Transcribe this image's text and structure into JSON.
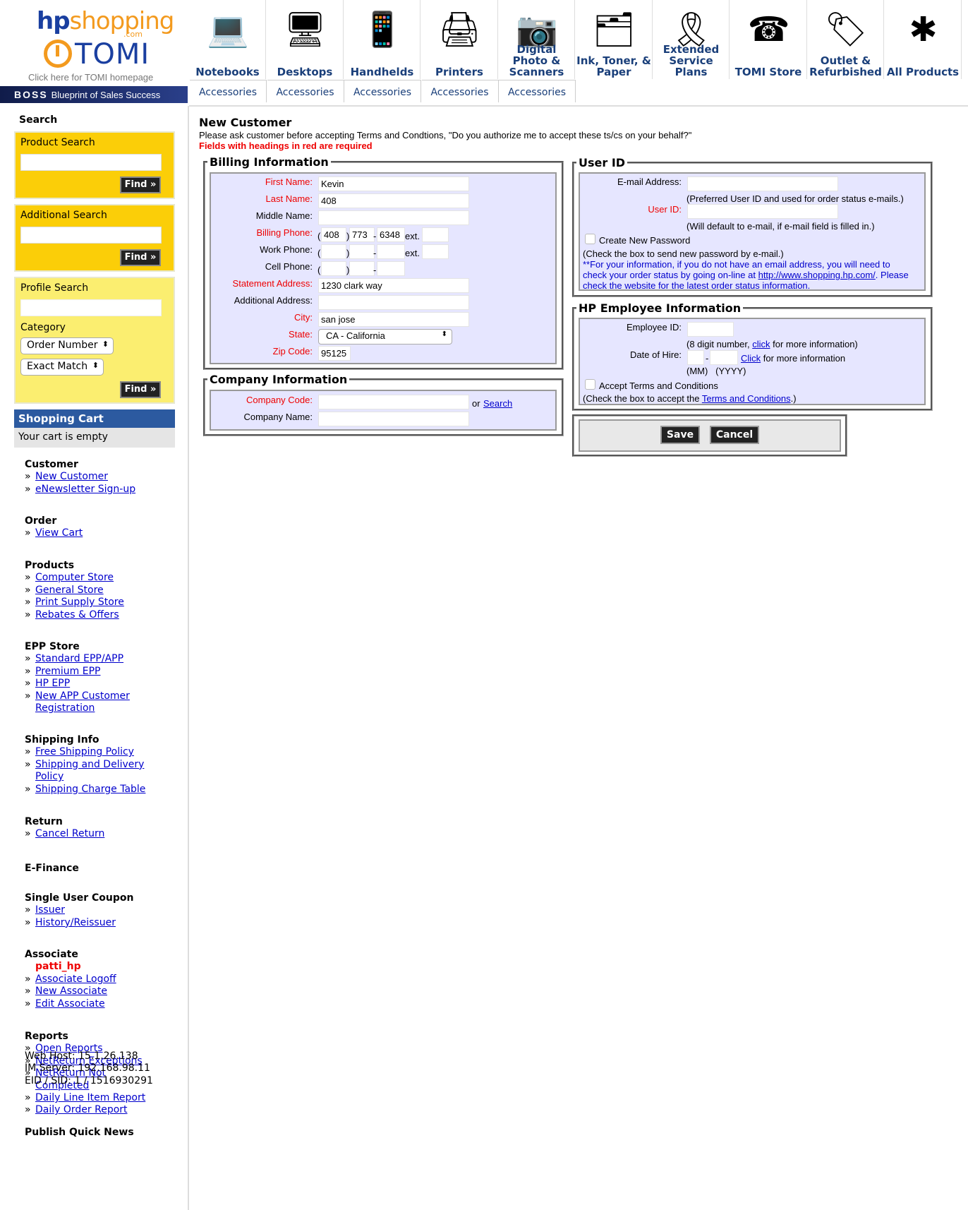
{
  "logo": {
    "hp": "hp",
    "shopping": "shopping",
    "com": ".com",
    "tomi": "TOMI",
    "caption": "Click here for TOMI homepage",
    "boss": "BOSS",
    "boss_tagline": "Blueprint of Sales Success"
  },
  "nav": {
    "categories": [
      {
        "label": "Notebooks",
        "icon": "laptop-icon",
        "glyph": "💻"
      },
      {
        "label": "Desktops",
        "icon": "desktop-icon",
        "glyph": "🖥"
      },
      {
        "label": "Handhelds",
        "icon": "handheld-icon",
        "glyph": "📱"
      },
      {
        "label": "Printers",
        "icon": "printer-icon",
        "glyph": "🖨"
      },
      {
        "label": "Digital Photo & Scanners",
        "icon": "camera-icon",
        "glyph": "📷"
      },
      {
        "label": "Ink, Toner, & Paper",
        "icon": "ink-icon",
        "glyph": "🗂"
      },
      {
        "label": "Extended Service Plans",
        "icon": "ribbon-icon",
        "glyph": "🎗"
      },
      {
        "label": "TOMI Store",
        "icon": "phone-icon",
        "glyph": "☎"
      },
      {
        "label": "Outlet & Refurbished",
        "icon": "tag-icon",
        "glyph": "🏷"
      },
      {
        "label": "All Products",
        "icon": "asterisk-icon",
        "glyph": "✱"
      }
    ],
    "accessories": [
      "Accessories",
      "Accessories",
      "Accessories",
      "Accessories",
      "Accessories"
    ]
  },
  "sidebar": {
    "search_title": "Search",
    "product_search": {
      "title": "Product Search",
      "find": "Find »"
    },
    "additional_search": {
      "title": "Additional Search",
      "find": "Find »"
    },
    "profile_search": {
      "title": "Profile Search",
      "category_label": "Category",
      "category_value": "Order Number",
      "match_value": "Exact Match",
      "find": "Find »"
    },
    "cart": {
      "title": "Shopping Cart",
      "status": "Your cart is empty"
    },
    "sections": {
      "customer": {
        "title": "Customer",
        "links": [
          "New Customer",
          "eNewsletter Sign-up"
        ]
      },
      "order": {
        "title": "Order",
        "links": [
          "View Cart"
        ]
      },
      "products": {
        "title": "Products",
        "links": [
          "Computer Store",
          "General Store",
          "Print Supply Store",
          "Rebates & Offers"
        ]
      },
      "epp": {
        "title": "EPP Store",
        "links": [
          "Standard EPP/APP",
          "Premium EPP",
          "HP EPP",
          "New APP Customer Registration"
        ]
      },
      "shipping": {
        "title": "Shipping Info",
        "links": [
          "Free Shipping Policy",
          "Shipping and Delivery Policy",
          "Shipping Charge Table"
        ]
      },
      "return": {
        "title": "Return",
        "links": [
          "Cancel Return"
        ]
      },
      "efinance": {
        "title": "E-Finance"
      },
      "coupon": {
        "title": "Single User Coupon",
        "links": [
          "Issuer",
          "History/Reissuer"
        ]
      },
      "associate": {
        "title": "Associate",
        "user": "patti_hp",
        "links": [
          "Associate Logoff",
          "New Associate",
          "Edit Associate"
        ]
      },
      "reports": {
        "title": "Reports",
        "links": [
          "Open Reports",
          "NetReturn Exceptions",
          "NetReturn Not Completed",
          "Daily Line Item Report",
          "Daily Order Report"
        ]
      },
      "news": {
        "title": "Publish Quick News"
      }
    },
    "server": {
      "web_host": "Web Host: 15.1.26.138",
      "im_server": "IM Server: 192.168.98.11",
      "eid_sid": "EID / SID: 1 / 1516930291"
    }
  },
  "form": {
    "title": "New Customer",
    "instruction": "Please ask customer before accepting Terms and Condtions, \"Do you authorize me to accept these ts/cs on your behalf?\"",
    "required_note": "Fields with headings in red are required",
    "billing": {
      "legend": "Billing Information",
      "first_name_label": "First Name:",
      "first_name": "Kevin",
      "last_name_label": "Last Name:",
      "last_name": "408",
      "middle_name_label": "Middle Name:",
      "middle_name": "",
      "billing_phone_label": "Billing Phone:",
      "billing_phone_area": "408",
      "billing_phone_prefix": "773",
      "billing_phone_line": "6348",
      "work_phone_label": "Work Phone:",
      "cell_phone_label": "Cell Phone:",
      "ext_label": "ext.",
      "paren_open": "(",
      "paren_close": ")",
      "dash": "-",
      "statement_address_label": "Statement Address:",
      "statement_address": "1230 clark way",
      "additional_address_label": "Additional Address:",
      "additional_address": "",
      "city_label": "City:",
      "city": "san jose",
      "state_label": "State:",
      "state": "CA - California",
      "zip_label": "Zip Code:",
      "zip": "95125"
    },
    "company": {
      "legend": "Company Information",
      "code_label": "Company Code:",
      "code": "",
      "or": "or",
      "search_link": "Search",
      "name_label": "Company Name:",
      "name": ""
    },
    "userid": {
      "legend": "User ID",
      "email_label": "E-mail Address:",
      "email": "",
      "email_note": "(Preferred User ID and used for order status e-mails.)",
      "userid_label": "User ID:",
      "userid": "",
      "userid_note": "(Will default to e-mail, if e-mail field is filled in.)",
      "new_password_label": "Create New Password",
      "new_password_note": "(Check the box to send new password by e-mail.)",
      "info_line1": "**For your information, if you do not have an email address, you will need to",
      "info_line2_pre": "check your order status by going on-line at ",
      "info_link": "http://www.shopping.hp.com/",
      "info_line2_post": ". Please",
      "info_line3": "check the website for the latest order status information."
    },
    "employee": {
      "legend": "HP Employee Information",
      "id_label": "Employee ID:",
      "id": "",
      "id_note_pre": "(8 digit number, ",
      "id_note_link": "click",
      "id_note_post": " for more information)",
      "hire_label": "Date of Hire:",
      "hire_dash": "-",
      "hire_link": "Click",
      "hire_note": " for more information",
      "hire_format": "(MM)   (YYYY)",
      "terms_label": "Accept Terms and Conditions",
      "terms_note_pre": "(Check the box to accept the ",
      "terms_link": "Terms and Conditions",
      "terms_note_post": ".)"
    },
    "buttons": {
      "save": "Save",
      "cancel": "Cancel"
    }
  }
}
